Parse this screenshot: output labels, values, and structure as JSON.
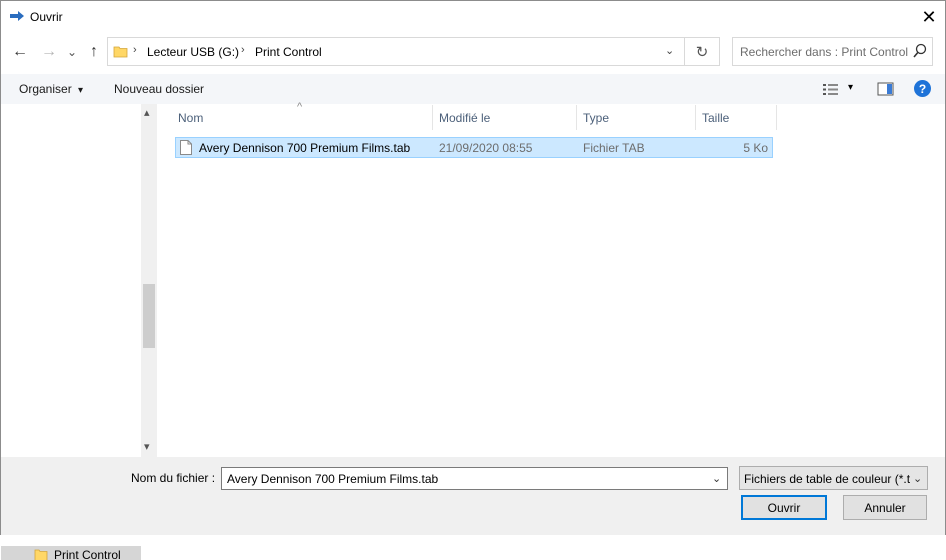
{
  "window": {
    "title": "Ouvrir",
    "close_glyph": "✕"
  },
  "nav": {
    "back_glyph": "←",
    "forward_glyph": "→",
    "recent_glyph": "⌄",
    "up_glyph": "↑"
  },
  "address": {
    "separator": "›",
    "crumbs": [
      "Lecteur USB (G:)",
      "Print Control"
    ],
    "dropdown_glyph": "⌄",
    "refresh_glyph": "↻"
  },
  "search": {
    "placeholder": "Rechercher dans : Print Control"
  },
  "toolbar": {
    "organize_label": "Organiser",
    "organize_arrow": "▾",
    "new_folder_label": "Nouveau dossier",
    "view_arrow": "▾",
    "help_glyph": "?"
  },
  "left_nav": {
    "scroll_up": "▴",
    "scroll_down": "▾",
    "selected_item": "Print Control"
  },
  "columns": {
    "name": "Nom",
    "modified": "Modifié le",
    "type": "Type",
    "size": "Taille",
    "sort_glyph": "^"
  },
  "files": [
    {
      "name": "Avery Dennison 700 Premium Films.tab",
      "modified": "21/09/2020 08:55",
      "type": "Fichier TAB",
      "size": "5 Ko"
    }
  ],
  "footer": {
    "filename_label": "Nom du fichier :",
    "filename_value": "Avery Dennison 700 Premium Films.tab",
    "filter_value": "Fichiers de table de couleur (*.t",
    "open_label": "Ouvrir",
    "cancel_label": "Annuler",
    "dd_glyph": "⌄"
  },
  "colors": {
    "selection": "#cce8ff",
    "selection_border": "#99d1ff",
    "accent": "#0078d7",
    "folder": "#ffd766"
  }
}
